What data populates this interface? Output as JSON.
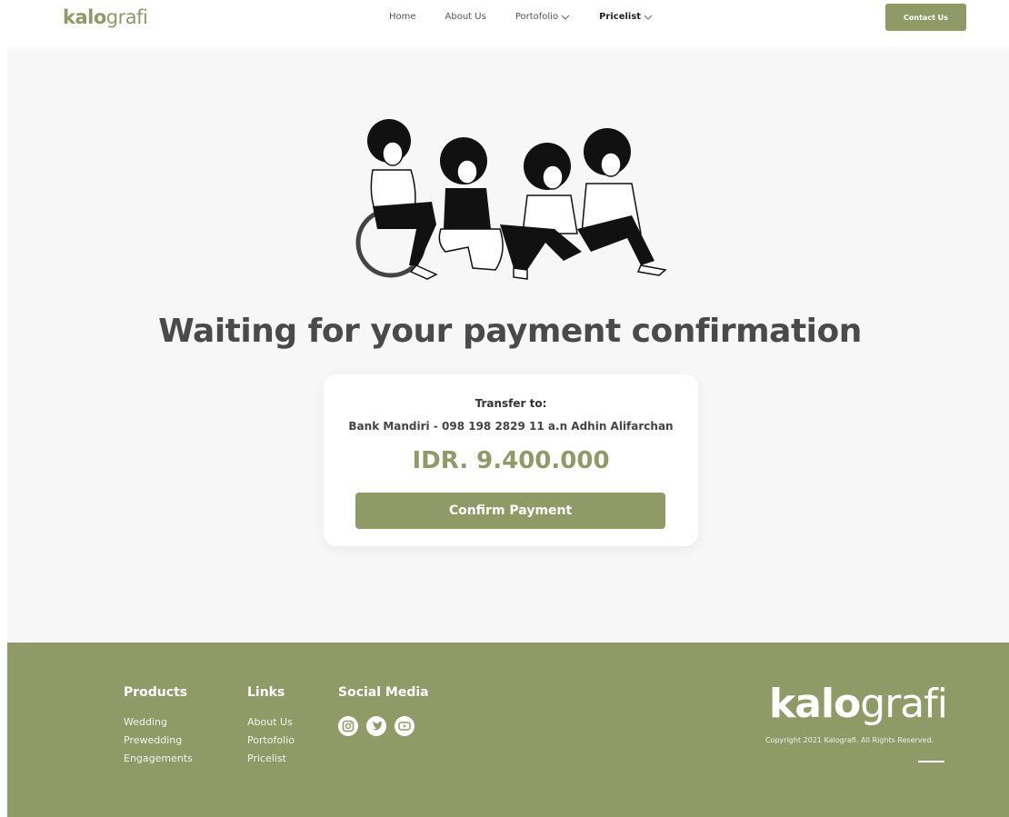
{
  "header": {
    "logo_bold": "kalo",
    "logo_light": "grafi",
    "nav": [
      {
        "label": "Home"
      },
      {
        "label": "About Us"
      },
      {
        "label": "Portofolio"
      },
      {
        "label": "Pricelist"
      }
    ],
    "contact_label": "Contact Us"
  },
  "main": {
    "title": "Waiting for your payment confirmation",
    "transfer_label": "Transfer to:",
    "bank_line": "Bank Mandiri -  098 198 2829 11 a.n Adhin Alifarchan",
    "amount": "IDR. 9.400.000",
    "confirm_label": "Confirm Payment"
  },
  "footer": {
    "products_title": "Products",
    "products": [
      "Wedding",
      "Prewedding",
      "Engagements"
    ],
    "links_title": "Links",
    "links": [
      "About Us",
      "Portofolio",
      "Pricelist"
    ],
    "social_title": "Social Media",
    "socials": [
      "instagram-icon",
      "twitter-icon",
      "youtube-icon"
    ],
    "logo_bold": "kalo",
    "logo_light": "grafi",
    "copyright": "Copyright 2021 Kalografi. All Rights Reserved."
  },
  "colors": {
    "accent": "#8f9a67",
    "page_bg": "#f7f7f7",
    "title": "#4a4a4a"
  }
}
